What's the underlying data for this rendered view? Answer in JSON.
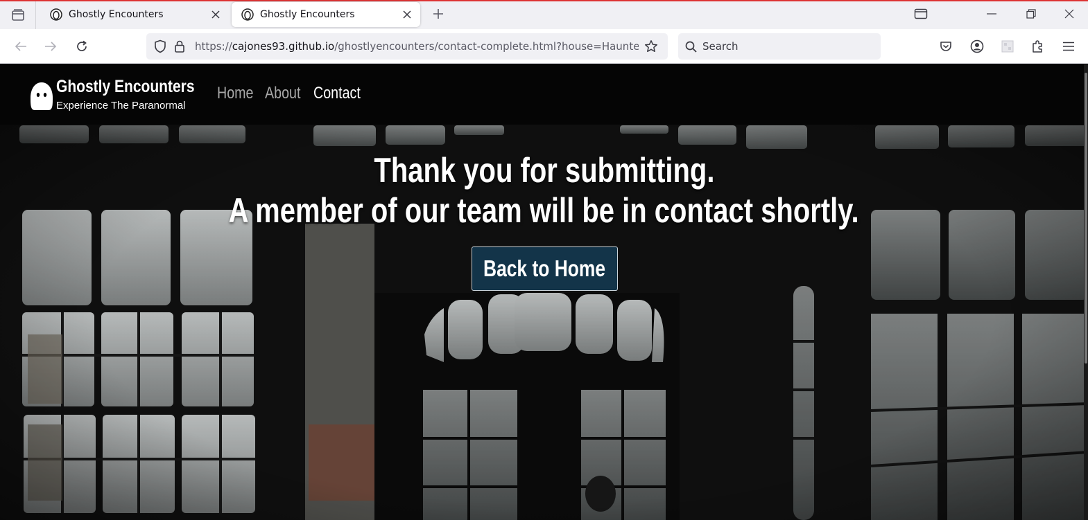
{
  "browser": {
    "tabs": [
      {
        "title": "Ghostly Encounters",
        "active": false
      },
      {
        "title": "Ghostly Encounters",
        "active": true
      }
    ],
    "url": {
      "scheme": "https://",
      "domain": "cajones93.github.io",
      "path": "/ghostlyencounters/contact-complete.html?house=Haunte"
    },
    "search_placeholder": "Search",
    "icons": {
      "tab_overview": "tab-overview-icon",
      "back": "back-arrow-icon",
      "forward": "forward-arrow-icon",
      "reload": "reload-icon",
      "shield": "tracking-shield-icon",
      "lock": "lock-icon",
      "bookmark": "bookmark-star-icon",
      "pocket": "pocket-icon",
      "account": "account-icon",
      "extension": "extension-puzzle-icon",
      "menu": "hamburger-menu-icon"
    }
  },
  "site": {
    "brand_title": "Ghostly Encounters",
    "brand_subtitle": "Experience The Paranormal",
    "nav": [
      {
        "label": "Home",
        "current": false
      },
      {
        "label": "About",
        "current": false
      },
      {
        "label": "Contact",
        "current": true
      }
    ],
    "message_line1": "Thank you for submitting.",
    "message_line2": "A member of our team will be in contact shortly.",
    "button_label": "Back to Home",
    "colors": {
      "nav_bg": "#050505",
      "button_bg": "#133449",
      "nav_inactive": "#a8a8a8",
      "nav_active": "#ffffff"
    }
  }
}
